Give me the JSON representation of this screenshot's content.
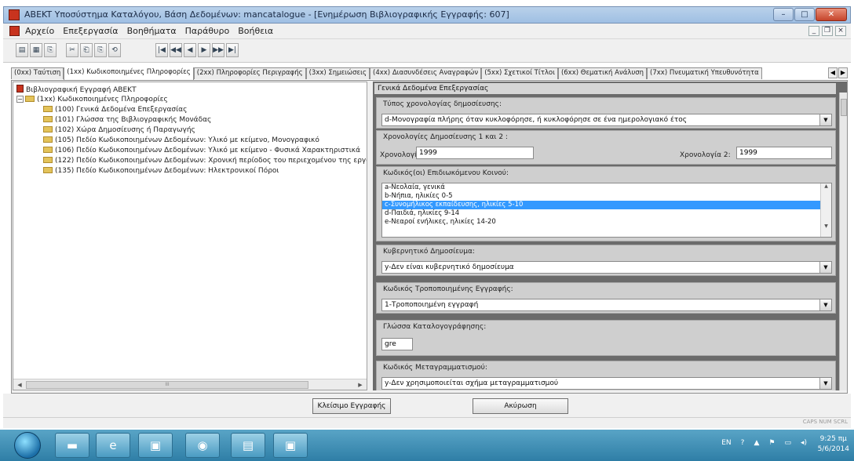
{
  "window": {
    "title": "ABEKT Υποσύστημα Καταλόγου, Βάση Δεδομένων: mancatalogue - [Ενημέρωση Βιβλιογραφικής Εγγραφής: 607]",
    "min_label": "–",
    "max_label": "□",
    "close_label": "✕"
  },
  "menu": {
    "items": [
      "Αρχείο",
      "Επεξεργασία",
      "Βοηθήματα",
      "Παράθυρο",
      "Βοήθεια"
    ],
    "mdi_controls": [
      "_",
      "❐",
      "×"
    ]
  },
  "toolbar": {
    "group1": [
      "▤",
      "▦",
      "⎘"
    ],
    "group2": [
      "✂",
      "⎗",
      "⎘",
      "⟲"
    ],
    "nav": [
      "|◀",
      "◀◀",
      "◀",
      "▶",
      "▶▶",
      "▶|"
    ]
  },
  "tabs": [
    "(0xx) Ταύτιση",
    "(1xx) Κωδικοποιημένες Πληροφορίες",
    "(2xx) Πληροφορίες Περιγραφής",
    "(3xx) Σημειώσεις",
    "(4xx) Διασυνδέσεις Αναγραφών",
    "(5xx) Σχετικοί Τίτλοι",
    "(6xx) Θεματική Ανάλυση",
    "(7xx) Πνευματική Υπευθυνότητα"
  ],
  "tab_arrows": [
    "◀",
    "▶"
  ],
  "tree": {
    "root": "Βιβλιογραφική Εγγραφή ΑΒΕΚΤ",
    "group_toggle": "−",
    "group": "(1xx) Κωδικοποιημένες Πληροφορίες",
    "children": [
      "(100) Γενικά Δεδομένα Επεξεργασίας",
      "(101) Γλώσσα της Βιβλιογραφικής Μονάδας",
      "(102) Χώρα Δημοσίευσης ή Παραγωγής",
      "(105) Πεδίο Κωδικοποιημένων Δεδομένων: Υλικό με κείμενο, Μονογραφικό",
      "(106) Πεδίο Κωδικοποιημένων Δεδομένων: Υλικό με κείμενο - Φυσικά Χαρακτηριστικά",
      "(122) Πεδίο Κωδικοποιημένων Δεδομένων: Χρονική περίοδος του περιεχομένου της εργασίας",
      "(135) Πεδίο Κωδικοποιημένων Δεδομένων: Ηλεκτρονικοί Πόροι"
    ],
    "hscroll_thumb": "III"
  },
  "panel": {
    "header": "Γενικά Δεδομένα Επεξεργασίας",
    "pub_date_type_label": "Τύπος χρονολογίας δημοσίευσης:",
    "pub_date_type_value": "d-Μονογραφία πλήρης όταν κυκλοφόρησε, ή κυκλοφόρησε σε ένα ημερολογιακό έτος",
    "pub_dates_label": "Χρονολογίες Δημοσίευσης 1 και 2 :",
    "date1_label": "Χρονολογία 1:",
    "date1_value": "1999",
    "date2_label": "Χρονολογία 2:",
    "date2_value": "1999",
    "audience_label": "Κωδικός(οι) Επιδιωκόμενου Κοινού:",
    "audience_items": [
      "a-Νεολαία, γενικά",
      "b-Νήπια, ηλικίες 0-5",
      "c-Συνομήλικος εκπαίδευσης, ηλικίες 5-10",
      "d-Παιδιά, ηλικίες 9-14",
      "e-Νεαροί ενήλικες, ηλικίες 14-20"
    ],
    "audience_selected": 2,
    "gov_label": "Κυβερνητικό Δημοσίευμα:",
    "gov_value": "y-Δεν είναι κυβερνητικό δημοσίευμα",
    "mod_label": "Κωδικός Τροποποιημένης Εγγραφής:",
    "mod_value": "1-Τροποποιημένη εγγραφή",
    "lang_label": "Γλώσσα Καταλογογράφησης:",
    "lang_value": "gre",
    "translit_label": "Κωδικός Μεταγραμματισμού:",
    "translit_value": "y-Δεν χρησιμοποιείται σχήμα μεταγραμματισμού",
    "dropdown_glyph": "▼",
    "list_scroll_up": "▲",
    "list_scroll_down": "▼"
  },
  "buttons": {
    "close_record": "Κλείσιμο Εγγραφής",
    "cancel": "Ακύρωση"
  },
  "status": {
    "indicators": "CAPS  NUM  SCRL"
  },
  "taskbar": {
    "lang": "EN",
    "time": "9:25 πμ",
    "date": "5/6/2014"
  }
}
